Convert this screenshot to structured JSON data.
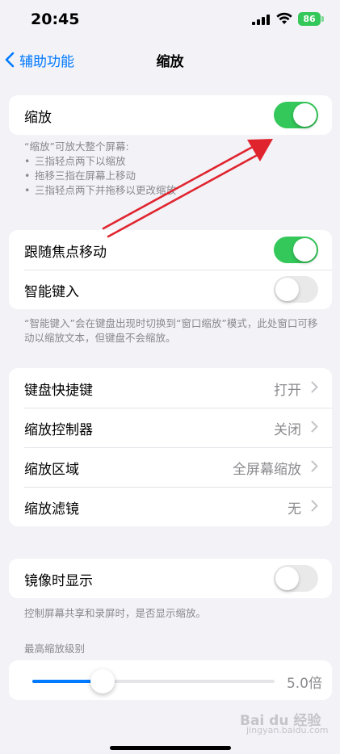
{
  "status": {
    "time": "20:45",
    "battery": "86"
  },
  "nav": {
    "back_label": "辅助功能",
    "title": "缩放"
  },
  "zoom": {
    "label": "缩放",
    "enabled": true,
    "footnote_title": "“缩放”可放大整个屏幕:",
    "footnote_items": [
      "三指轻点两下以缩放",
      "拖移三指在屏幕上移动",
      "三指轻点两下并拖移以更改缩放"
    ]
  },
  "focus": {
    "follow_label": "跟随焦点移动",
    "follow_enabled": true,
    "smart_typing_label": "智能键入",
    "smart_typing_enabled": false,
    "footnote": "“智能键入”会在键盘出现时切换到“窗口缩放”模式，此处窗口可移动以缩放文本，但键盘不会缩放。"
  },
  "options": [
    {
      "label": "键盘快捷键",
      "value": "打开"
    },
    {
      "label": "缩放控制器",
      "value": "关闭"
    },
    {
      "label": "缩放区域",
      "value": "全屏幕缩放"
    },
    {
      "label": "缩放滤镜",
      "value": "无"
    }
  ],
  "mirroring": {
    "label": "镜像时显示",
    "enabled": false,
    "footnote": "控制屏幕共享和录屏时，是否显示缩放。"
  },
  "max_zoom": {
    "header": "最高缩放级别",
    "value_label": "5.0倍",
    "level_fraction": 0.29
  },
  "watermark": {
    "text": "Bai du 经验",
    "sub": "jingyan.baidu.com"
  },
  "colors": {
    "accent": "#007aff",
    "toggle_on": "#34c759",
    "annotation_arrow": "#e0242e"
  }
}
